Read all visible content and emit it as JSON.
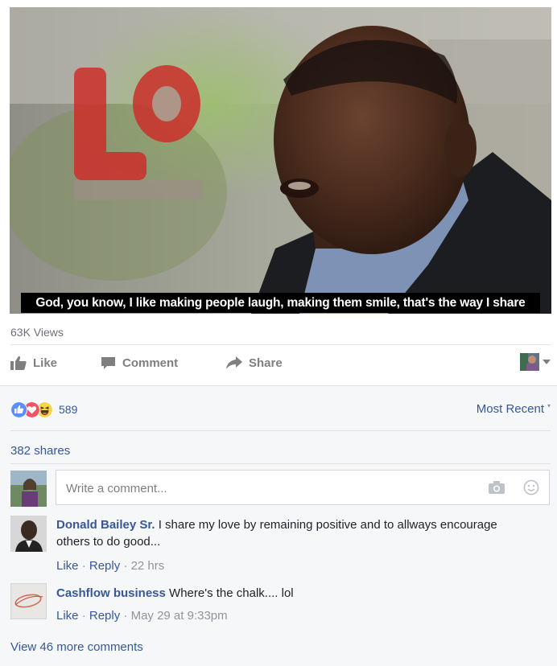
{
  "video": {
    "caption": "God, you know, I like making people laugh, making them smile, that's the way I share"
  },
  "stats": {
    "views": "63K Views"
  },
  "actions": {
    "like": "Like",
    "comment": "Comment",
    "share": "Share"
  },
  "reactions": {
    "count": "589",
    "icons": [
      "like-reaction-icon",
      "love-reaction-icon",
      "haha-reaction-icon"
    ],
    "colors": {
      "like": "#5890ff",
      "love": "#f25268",
      "haha": "#f7d44a"
    }
  },
  "sort": {
    "label": "Most Recent",
    "caret": "▾"
  },
  "shares": {
    "label": "382 shares"
  },
  "composer": {
    "placeholder": "Write a comment..."
  },
  "comments": [
    {
      "author": "Donald Bailey Sr.",
      "text": " I share my love by remaining positive and to allways encourage others to do good...",
      "like": "Like",
      "reply": "Reply",
      "time": "22 hrs"
    },
    {
      "author": "Cashflow business",
      "text": " Where's the chalk.... lol",
      "like": "Like",
      "reply": "Reply",
      "time": "May 29 at 9:33pm"
    }
  ],
  "more_comments": "View 46 more comments",
  "separator": "·",
  "colors": {
    "link": "#365899",
    "muted": "#90949c",
    "caption_bg": "#000000"
  }
}
